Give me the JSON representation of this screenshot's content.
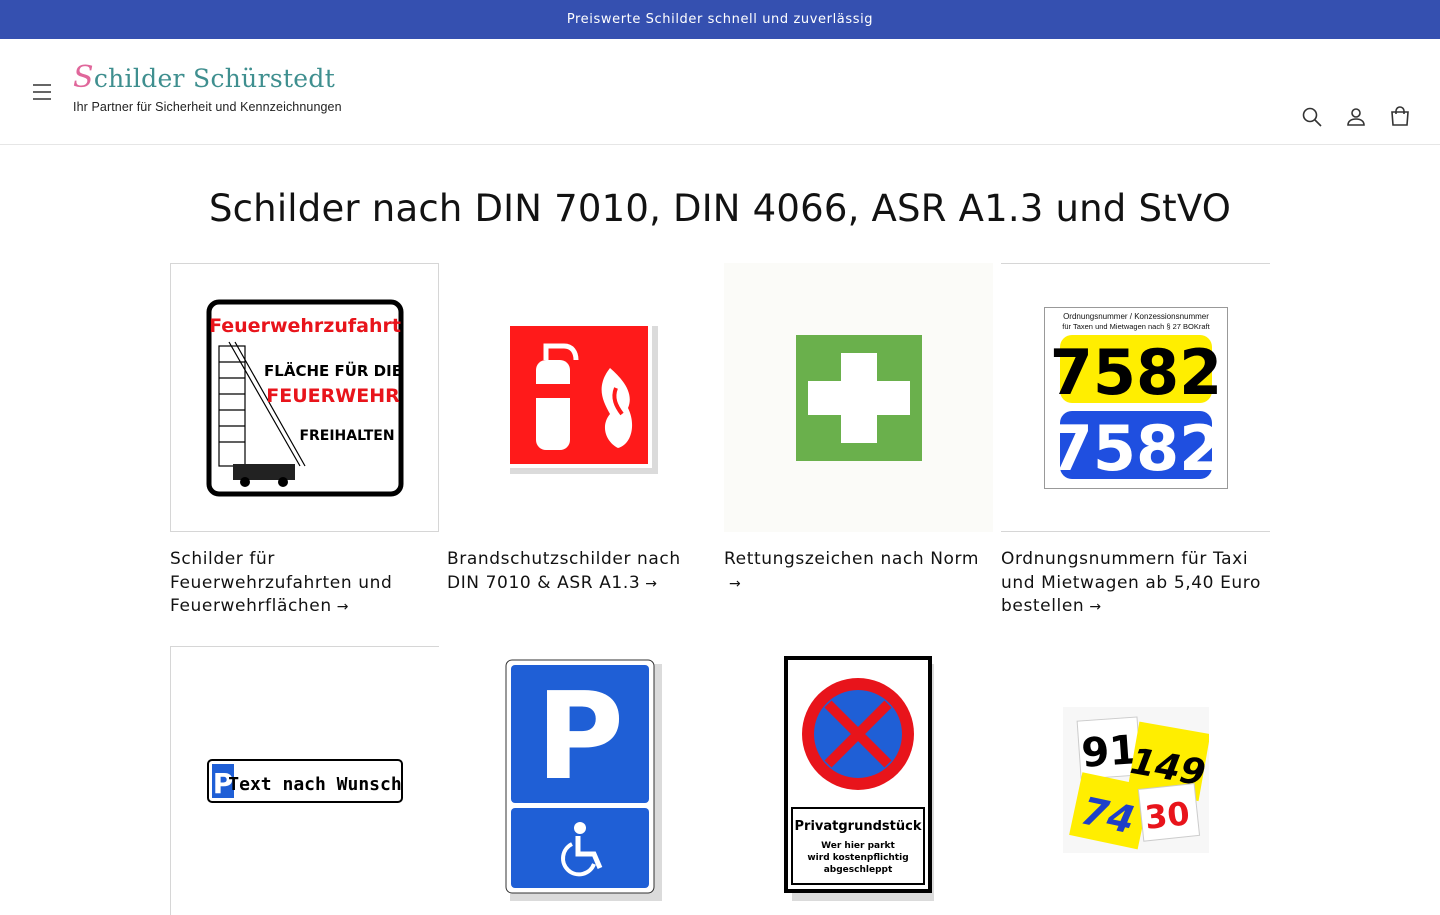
{
  "announcement": {
    "text": "Preiswerte Schilder schnell und zuverlässig"
  },
  "header": {
    "logo_first_letter": "S",
    "logo_rest": "childer Schürstedt",
    "logo_tagline": "Ihr Partner für Sicherheit und Kennzeichnungen",
    "icons": [
      "menu-icon",
      "search-icon",
      "account-icon",
      "cart-icon"
    ]
  },
  "main": {
    "title": "Schilder nach DIN 7010, DIN 4066, ASR A1.3 und StVO",
    "arrow": "→",
    "cards": [
      {
        "title": "Schilder für Feuerwehrzufahrten und Feuerwehrflächen",
        "image_text": {
          "line1": "Feuerwehrzufahrt",
          "line2": "FLÄCHE FÜR DIE",
          "line3": "FEUERWEHR",
          "line4": "FREIHALTEN"
        }
      },
      {
        "title": "Brandschutzschilder nach DIN 7010 & ASR A1.3"
      },
      {
        "title": "Rettungszeichen nach Norm"
      },
      {
        "title": "Ordnungsnummern für Taxi und Mietwagen ab 5,40 Euro bestellen",
        "image_text": {
          "caption1": "Ordnungsnummer / Konzessionsnummer",
          "caption2": "für Taxen und Mietwagen nach § 27 BOKraft",
          "number_yellow": "7582",
          "number_blue": "7582"
        }
      },
      {
        "title": "",
        "image_text": {
          "p": "P",
          "text": "Text nach Wunsch"
        }
      },
      {
        "title": "",
        "image_text": {
          "p": "P"
        }
      },
      {
        "title": "",
        "image_text": {
          "line1": "Privatgrundstück",
          "line2": "Wer hier parkt",
          "line3": "wird kostenpflichtig",
          "line4": "abgeschleppt"
        }
      },
      {
        "title": "",
        "image_text": {
          "n1": "91",
          "n2": "149",
          "n3": "74",
          "n4": "30"
        }
      }
    ]
  },
  "colors": {
    "announcement_bg": "#3550b0",
    "logo_teal": "#3f8f8f",
    "logo_pink": "#e0679b",
    "fire_red": "#ff1a1a",
    "rescue_green": "#6ab04c",
    "parking_blue": "#1f5fd6",
    "taxi_yellow": "#ffee00"
  }
}
